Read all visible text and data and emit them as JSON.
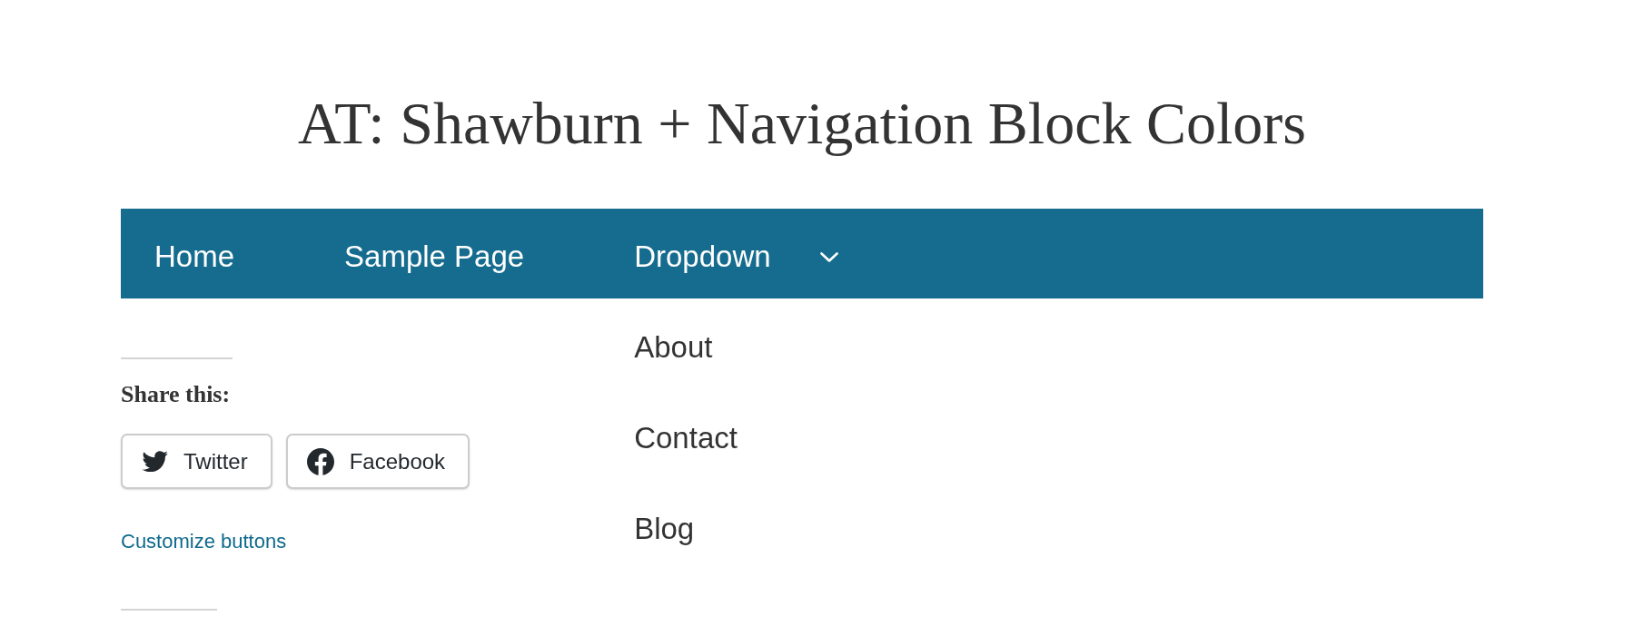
{
  "page": {
    "title": "AT: Shawburn + Navigation Block Colors"
  },
  "navigation": {
    "items": [
      {
        "label": "Home",
        "kind": "link"
      },
      {
        "label": "Sample Page",
        "kind": "link"
      },
      {
        "label": "Dropdown",
        "kind": "submenu",
        "expanded": true,
        "children": [
          {
            "label": "About"
          },
          {
            "label": "Contact"
          },
          {
            "label": "Blog"
          }
        ]
      }
    ]
  },
  "sharing": {
    "heading": "Share this:",
    "buttons": [
      {
        "label": "Twitter",
        "kind": "twitter"
      },
      {
        "label": "Facebook",
        "kind": "facebook"
      }
    ],
    "customize_link": "Customize buttons"
  }
}
